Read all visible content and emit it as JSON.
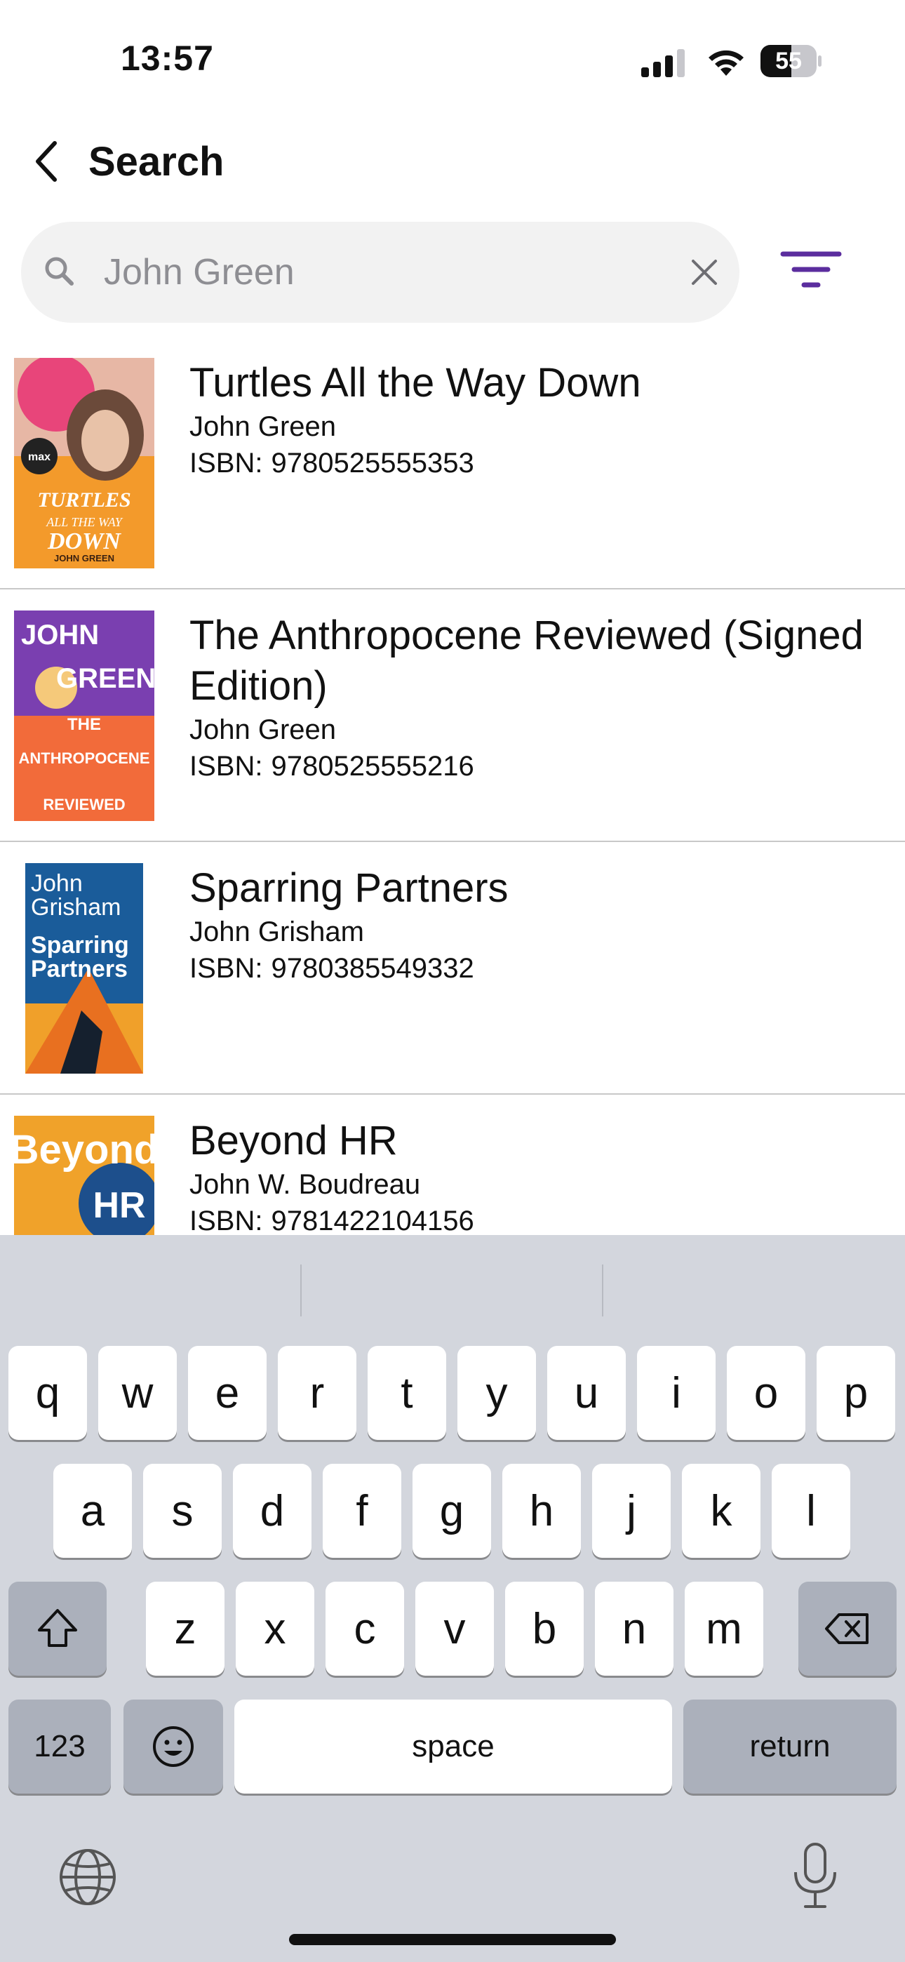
{
  "status_bar": {
    "time": "13:57",
    "battery_level": "55",
    "battery_fraction": 0.55
  },
  "nav": {
    "back_icon": "chevron-left-icon",
    "title": "Search"
  },
  "search": {
    "value": "",
    "placeholder": "John Green",
    "search_icon": "magnifying-glass-icon",
    "clear_icon": "close-icon",
    "filter_icon": "filter-icon",
    "accent_color": "#5b2d9e"
  },
  "results": [
    {
      "title": "Turtles All the Way Down",
      "author": "John Green",
      "isbn_label": "ISBN:",
      "isbn": "9780525555353",
      "cover_text": "TURTLES ALL THE WAY DOWN",
      "cover_author": "JOHN GREEN",
      "cover_badge": "max"
    },
    {
      "title": "The Anthropocene Reviewed (Signed Edition)",
      "author": "John Green",
      "isbn_label": "ISBN:",
      "isbn": "9780525555216",
      "cover_line1": "JOHN",
      "cover_line2": "GREEN",
      "cover_line3": "THE",
      "cover_line4": "ANTHROPOCENE",
      "cover_line5": "REVIEWED"
    },
    {
      "title": "Sparring Partners",
      "author": "John Grisham",
      "isbn_label": "ISBN:",
      "isbn": "9780385549332",
      "cover_line1": "John",
      "cover_line2": "Grisham",
      "cover_line3": "Sparring",
      "cover_line4": "Partners"
    },
    {
      "title": "Beyond HR",
      "author": "John W. Boudreau",
      "isbn_label": "ISBN:",
      "isbn": "9781422104156",
      "cover_line1": "Beyond",
      "cover_line2": "HR"
    }
  ],
  "keyboard": {
    "row1": [
      "q",
      "w",
      "e",
      "r",
      "t",
      "y",
      "u",
      "i",
      "o",
      "p"
    ],
    "row2": [
      "a",
      "s",
      "d",
      "f",
      "g",
      "h",
      "j",
      "k",
      "l"
    ],
    "row3": [
      "z",
      "x",
      "c",
      "v",
      "b",
      "n",
      "m"
    ],
    "numbers_label": "123",
    "space_label": "space",
    "return_label": "return",
    "shift_icon": "shift-icon",
    "delete_icon": "delete-icon",
    "emoji_icon": "emoji-icon",
    "globe_icon": "globe-icon",
    "mic_icon": "microphone-icon"
  }
}
